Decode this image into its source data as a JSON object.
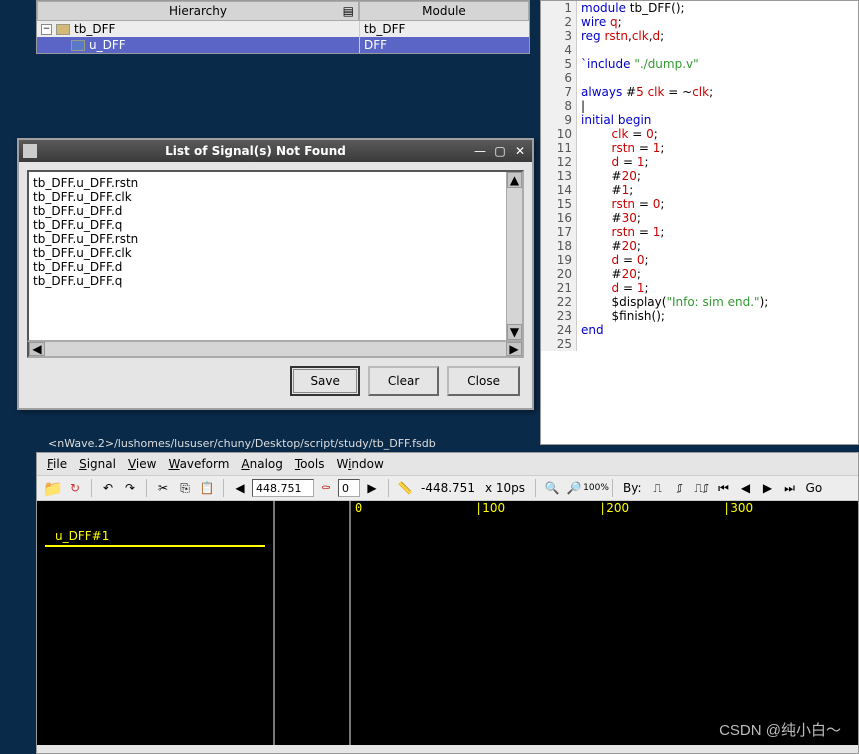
{
  "hierarchy": {
    "headers": {
      "col1": "Hierarchy",
      "col2": "Module"
    },
    "rows": [
      {
        "name": "tb_DFF",
        "module": "tb_DFF",
        "selected": false,
        "indent": 0
      },
      {
        "name": "u_DFF",
        "module": "DFF",
        "selected": true,
        "indent": 1
      }
    ]
  },
  "code": {
    "lines": [
      {
        "n": 1,
        "raw": "module tb_DFF();",
        "tokens": [
          [
            "kw",
            "module"
          ],
          [
            "",
            "",
            " tb_DFF();"
          ]
        ]
      },
      {
        "n": 2,
        "tokens": [
          [
            "kw",
            "wire"
          ],
          [
            "",
            " "
          ],
          [
            "ident",
            "q"
          ],
          [
            "",
            ";"
          ]
        ]
      },
      {
        "n": 3,
        "tokens": [
          [
            "kw",
            "reg"
          ],
          [
            "",
            " "
          ],
          [
            "ident",
            "rstn"
          ],
          [
            "",
            ","
          ],
          [
            "ident",
            "clk"
          ],
          [
            "",
            ","
          ],
          [
            "ident",
            "d"
          ],
          [
            "",
            ";"
          ]
        ]
      },
      {
        "n": 4,
        "tokens": [
          [
            "",
            ""
          ]
        ]
      },
      {
        "n": 5,
        "tokens": [
          [
            "kw",
            "`include"
          ],
          [
            "",
            " "
          ],
          [
            "str",
            "\"./dump.v\""
          ]
        ]
      },
      {
        "n": 6,
        "tokens": [
          [
            "",
            ""
          ]
        ]
      },
      {
        "n": 7,
        "tokens": [
          [
            "kw",
            "always"
          ],
          [
            "",
            " #"
          ],
          [
            "num",
            "5"
          ],
          [
            "",
            " "
          ],
          [
            "ident",
            "clk"
          ],
          [
            "",
            " = ~"
          ],
          [
            "ident",
            "clk"
          ],
          [
            "",
            ";"
          ]
        ]
      },
      {
        "n": 8,
        "tokens": [
          [
            "",
            "|"
          ]
        ]
      },
      {
        "n": 9,
        "tokens": [
          [
            "kw",
            "initial"
          ],
          [
            "",
            " "
          ],
          [
            "kw",
            "begin"
          ]
        ]
      },
      {
        "n": 10,
        "tokens": [
          [
            "",
            "        "
          ],
          [
            "ident",
            "clk"
          ],
          [
            "",
            " = "
          ],
          [
            "num",
            "0"
          ],
          [
            "",
            ";"
          ]
        ]
      },
      {
        "n": 11,
        "tokens": [
          [
            "",
            "        "
          ],
          [
            "ident",
            "rstn"
          ],
          [
            "",
            " = "
          ],
          [
            "num",
            "1"
          ],
          [
            "",
            ";"
          ]
        ]
      },
      {
        "n": 12,
        "tokens": [
          [
            "",
            "        "
          ],
          [
            "ident",
            "d"
          ],
          [
            "",
            " = "
          ],
          [
            "num",
            "1"
          ],
          [
            "",
            ";"
          ]
        ]
      },
      {
        "n": 13,
        "tokens": [
          [
            "",
            "        #"
          ],
          [
            "num",
            "20"
          ],
          [
            "",
            ";"
          ]
        ]
      },
      {
        "n": 14,
        "tokens": [
          [
            "",
            "        #"
          ],
          [
            "num",
            "1"
          ],
          [
            "",
            ";"
          ]
        ]
      },
      {
        "n": 15,
        "tokens": [
          [
            "",
            "        "
          ],
          [
            "ident",
            "rstn"
          ],
          [
            "",
            " = "
          ],
          [
            "num",
            "0"
          ],
          [
            "",
            ";"
          ]
        ]
      },
      {
        "n": 16,
        "tokens": [
          [
            "",
            "        #"
          ],
          [
            "num",
            "30"
          ],
          [
            "",
            ";"
          ]
        ]
      },
      {
        "n": 17,
        "tokens": [
          [
            "",
            "        "
          ],
          [
            "ident",
            "rstn"
          ],
          [
            "",
            " = "
          ],
          [
            "num",
            "1"
          ],
          [
            "",
            ";"
          ]
        ]
      },
      {
        "n": 18,
        "tokens": [
          [
            "",
            "        #"
          ],
          [
            "num",
            "20"
          ],
          [
            "",
            ";"
          ]
        ]
      },
      {
        "n": 19,
        "tokens": [
          [
            "",
            "        "
          ],
          [
            "ident",
            "d"
          ],
          [
            "",
            " = "
          ],
          [
            "num",
            "0"
          ],
          [
            "",
            ";"
          ]
        ]
      },
      {
        "n": 20,
        "tokens": [
          [
            "",
            "        #"
          ],
          [
            "num",
            "20"
          ],
          [
            "",
            ";"
          ]
        ]
      },
      {
        "n": 21,
        "tokens": [
          [
            "",
            "        "
          ],
          [
            "ident",
            "d"
          ],
          [
            "",
            " = "
          ],
          [
            "num",
            "1"
          ],
          [
            "",
            ";"
          ]
        ]
      },
      {
        "n": 22,
        "tokens": [
          [
            "",
            "        $display("
          ],
          [
            "str",
            "\"Info: sim end.\""
          ],
          [
            "",
            ");"
          ]
        ]
      },
      {
        "n": 23,
        "tokens": [
          [
            "",
            "        $finish();"
          ]
        ]
      },
      {
        "n": 24,
        "tokens": [
          [
            "kw",
            "end"
          ]
        ]
      },
      {
        "n": 25,
        "tokens": [
          [
            "",
            ""
          ]
        ]
      }
    ]
  },
  "dialog": {
    "title": "List of Signal(s) Not Found",
    "items": [
      "tb_DFF.u_DFF.rstn",
      "tb_DFF.u_DFF.clk",
      "tb_DFF.u_DFF.d",
      "tb_DFF.u_DFF.q",
      "tb_DFF.u_DFF.rstn",
      "tb_DFF.u_DFF.clk",
      "tb_DFF.u_DFF.d",
      "tb_DFF.u_DFF.q"
    ],
    "buttons": {
      "save": "Save",
      "clear": "Clear",
      "close": "Close"
    }
  },
  "wave": {
    "path": "<nWave.2>/lushomes/lususer/chuny/Desktop/script/study/tb_DFF.fsdb",
    "menu": {
      "file": "File",
      "signal": "Signal",
      "view": "View",
      "waveform": "Waveform",
      "analog": "Analog",
      "tools": "Tools",
      "window": "Window"
    },
    "toolbar": {
      "time_field": "448.751",
      "val_field": "0",
      "cursor_time": "-448.751",
      "resolution": "x 10ps",
      "by_label": "By:",
      "find_label": "Go"
    },
    "signal_list": {
      "row0": "u_DFF#1"
    },
    "ruler": {
      "t0": "0",
      "t100": "100",
      "t200": "200",
      "t300": "300"
    }
  },
  "watermark": "CSDN @纯小白～"
}
